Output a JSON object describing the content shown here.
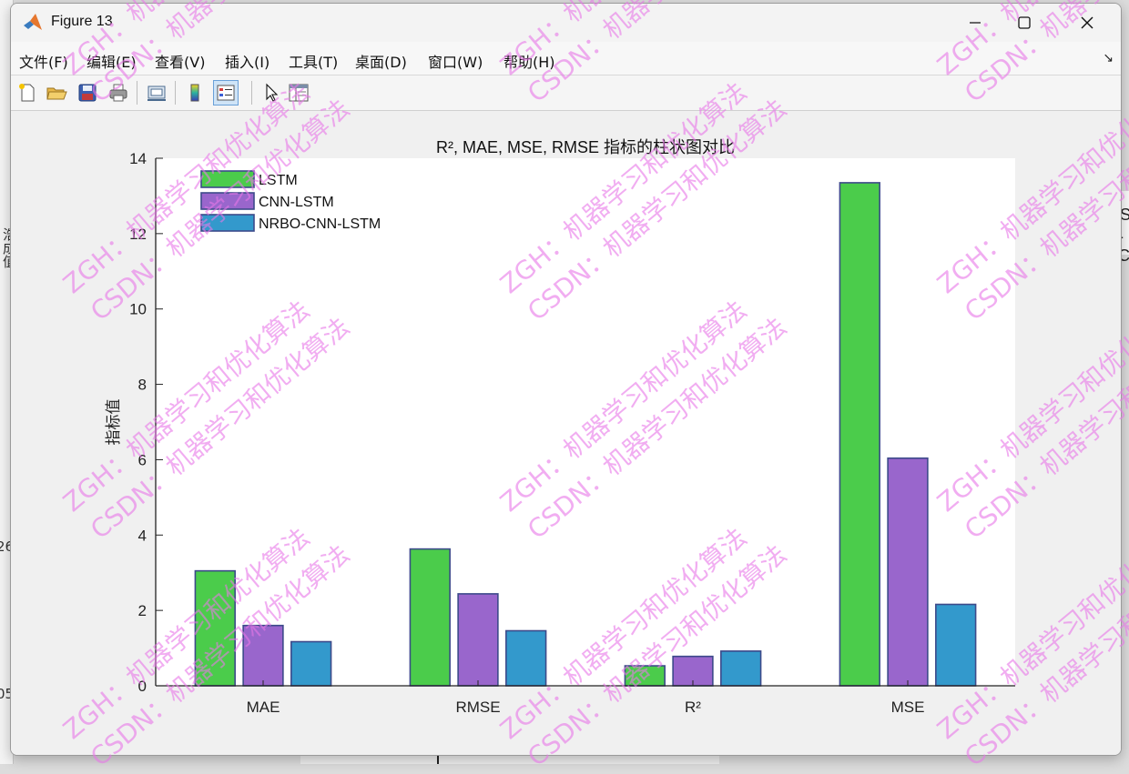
{
  "window": {
    "title": "Figure 13"
  },
  "menu": [
    "文件(F)",
    "编辑(E)",
    "查看(V)",
    "插入(I)",
    "工具(T)",
    "桌面(D)",
    "窗口(W)",
    "帮助(H)"
  ],
  "toolbar_icons": [
    "new-figure-icon",
    "open-folder-icon",
    "save-icon",
    "print-icon",
    "link-plot-icon",
    "colorbar-icon",
    "legend-icon",
    "pointer-icon",
    "property-inspector-icon"
  ],
  "background": {
    "left_snippets": [
      "浩成值",
      "26",
      "05"
    ],
    "right_snippets": [
      "S",
      "-C"
    ]
  },
  "chart_data": {
    "type": "bar",
    "title": "R², MAE, MSE, RMSE 指标的柱状图对比",
    "xlabel": "",
    "ylabel": "指标值",
    "categories": [
      "MAE",
      "RMSE",
      "R²",
      "MSE"
    ],
    "ylim": [
      0,
      14
    ],
    "yticks": [
      "0",
      "2",
      "4",
      "6",
      "8",
      "10",
      "12",
      "14"
    ],
    "grid": false,
    "legend_position": "top-left",
    "series": [
      {
        "name": "LSTM",
        "color": "#4bcc4b",
        "values": [
          3.05,
          3.63,
          0.53,
          13.35
        ]
      },
      {
        "name": "CNN-LSTM",
        "color": "#9966cc",
        "values": [
          1.6,
          2.44,
          0.78,
          6.04
        ]
      },
      {
        "name": "NRBO-CNN-LSTM",
        "color": "#3399cc",
        "values": [
          1.17,
          1.46,
          0.92,
          2.16
        ]
      }
    ]
  },
  "watermark": {
    "line1": "ZGH：机器学习和优化算法",
    "line2": "CSDN：机器学习和优化算法",
    "color": "#e878e8"
  }
}
